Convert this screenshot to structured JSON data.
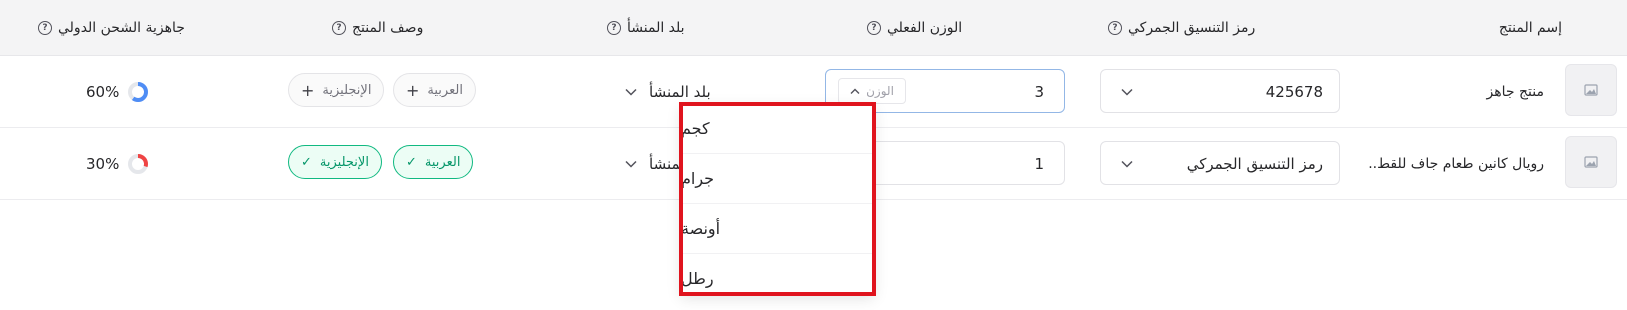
{
  "columns": {
    "product_name": "إسم المنتج",
    "hs_code": "رمز التنسيق الجمركي",
    "actual_weight": "الوزن الفعلي",
    "origin_country": "بلد المنشأ",
    "product_description": "وصف المنتج",
    "shipping_readiness": "جاهزية الشحن الدولي"
  },
  "rows": [
    {
      "name": "منتج جاهز",
      "hs_code": "425678",
      "weight": "3",
      "unit_placeholder": "الوزن",
      "origin": "بلد المنشأ",
      "desc_ar": "العربية",
      "desc_en": "الإنجليزية",
      "readiness": "60%",
      "readiness_value": 0.6,
      "readiness_color": "#4f8df5"
    },
    {
      "name": "رويال كانين طعام جاف للقط..",
      "hs_code": "رمز التنسيق الجمركي",
      "weight": "1",
      "origin": "بلد المنشأ",
      "desc_ar": "العربية",
      "desc_en": "الإنجليزية",
      "readiness": "30%",
      "readiness_value": 0.3,
      "readiness_color": "#ef4444"
    }
  ],
  "weight_units": [
    "كجم",
    "جرام",
    "أونصة",
    "رطل"
  ],
  "colors": {
    "green_accent": "#10b981",
    "highlight_red": "#e0141e"
  }
}
